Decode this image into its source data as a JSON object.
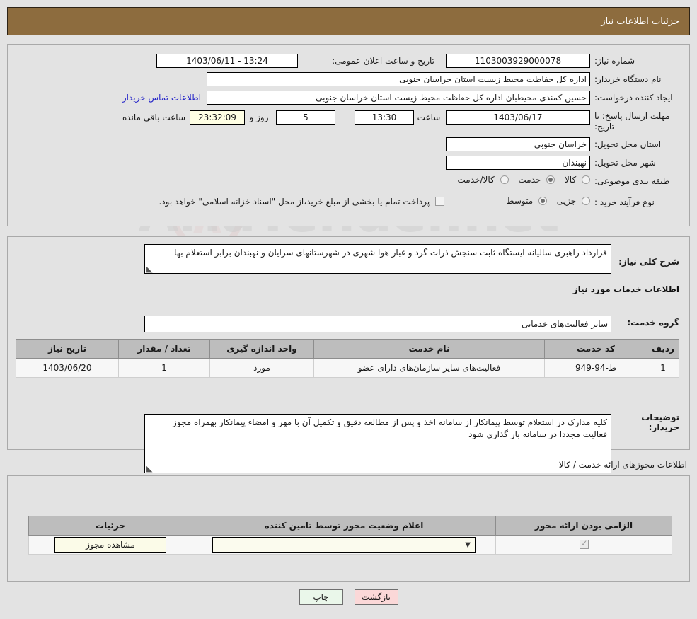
{
  "header": {
    "title": "جزئیات اطلاعات نیاز"
  },
  "top": {
    "need_number_label": "شماره نیاز:",
    "need_number_value": "1103003929000078",
    "announce_label": "تاریخ و ساعت اعلان عمومی:",
    "announce_value": "1403/06/11 - 13:24",
    "buyer_org_label": "نام دستگاه خریدار:",
    "buyer_org_value": "اداره کل حفاظت محیط زیست استان خراسان جنوبی",
    "creator_label": "ایجاد کننده درخواست:",
    "creator_value": "حسین کمندی محیطبان  اداره کل حفاظت محیط زیست استان خراسان جنوبی",
    "contact_link": "اطلاعات تماس خریدار",
    "deadline_label": "مهلت ارسال پاسخ: تا تاریخ:",
    "deadline_date": "1403/06/17",
    "hour_label": "ساعت",
    "deadline_time": "13:30",
    "days_value": "5",
    "days_label": "روز و",
    "countdown_value": "23:32:09",
    "remaining_label": "ساعت باقی مانده",
    "province_label": "استان محل تحویل:",
    "province_value": "خراسان جنوبی",
    "city_label": "شهر محل تحویل:",
    "city_value": "نهبندان",
    "category_label": "طبقه بندی موضوعی:",
    "category_options": [
      {
        "label": "کالا",
        "selected": false
      },
      {
        "label": "خدمت",
        "selected": true
      },
      {
        "label": "کالا/خدمت",
        "selected": false
      }
    ],
    "process_label": "نوع فرآیند خرید :",
    "process_options": [
      {
        "label": "جزیی",
        "selected": false
      },
      {
        "label": "متوسط",
        "selected": true
      }
    ],
    "treasury_checked": false,
    "treasury_text": "پرداخت تمام یا بخشی از مبلغ خرید،از محل \"اسناد خزانه اسلامی\" خواهد بود."
  },
  "mid": {
    "summary_label": "شرح کلی نیاز:",
    "summary_value": "قرارداد راهبری سالیانه ایستگاه ثابت سنجش ذرات گرد و غبار هوا شهری در شهرستانهای سرایان و نهبندان برابر استعلام بها",
    "services_section_title": "اطلاعات خدمات مورد نیاز",
    "service_group_label": "گروه خدمت:",
    "service_group_value": "سایر فعالیت‌های خدماتی",
    "table": {
      "headers": [
        "ردیف",
        "کد خدمت",
        "نام خدمت",
        "واحد اندازه گیری",
        "تعداد / مقدار",
        "تاریخ نیاز"
      ],
      "rows": [
        [
          "1",
          "ط-94-949",
          "فعالیت‌های سایر سازمان‌های دارای عضو",
          "مورد",
          "1",
          "1403/06/20"
        ]
      ]
    },
    "notes_label": "توضیحات خریدار:",
    "notes_value": "کلیه مدارک در استعلام توسط پیمانکار از سامانه اخذ و پس از مطالعه دقیق و تکمیل آن با مهر و امضاء پیمانکار بهمراه مجوز فعالیت مجددا در سامانه بار گذاری شود"
  },
  "bottom": {
    "section_title": "اطلاعات مجوزهای ارائه خدمت / کالا",
    "table": {
      "headers": [
        "الزامی بودن ارائه مجوز",
        "اعلام وضعیت مجوز توسط تامین کننده",
        "جزئیات"
      ],
      "rows": [
        {
          "required_checked": true,
          "status_value": "--",
          "details_button": "مشاهده مجوز"
        }
      ]
    }
  },
  "footer": {
    "print_label": "چاپ",
    "back_label": "بازگشت"
  },
  "watermark": {
    "text": "AriaTender.net"
  },
  "colors": {
    "header_bar": "#8d6c3e",
    "page_bg": "#e3e3e3",
    "link": "#2424c8",
    "table_header": "#bdbdbd",
    "highlight_field": "#ffffe4",
    "print_btn": "#eaf7ea",
    "back_btn": "#fbd8d8"
  }
}
